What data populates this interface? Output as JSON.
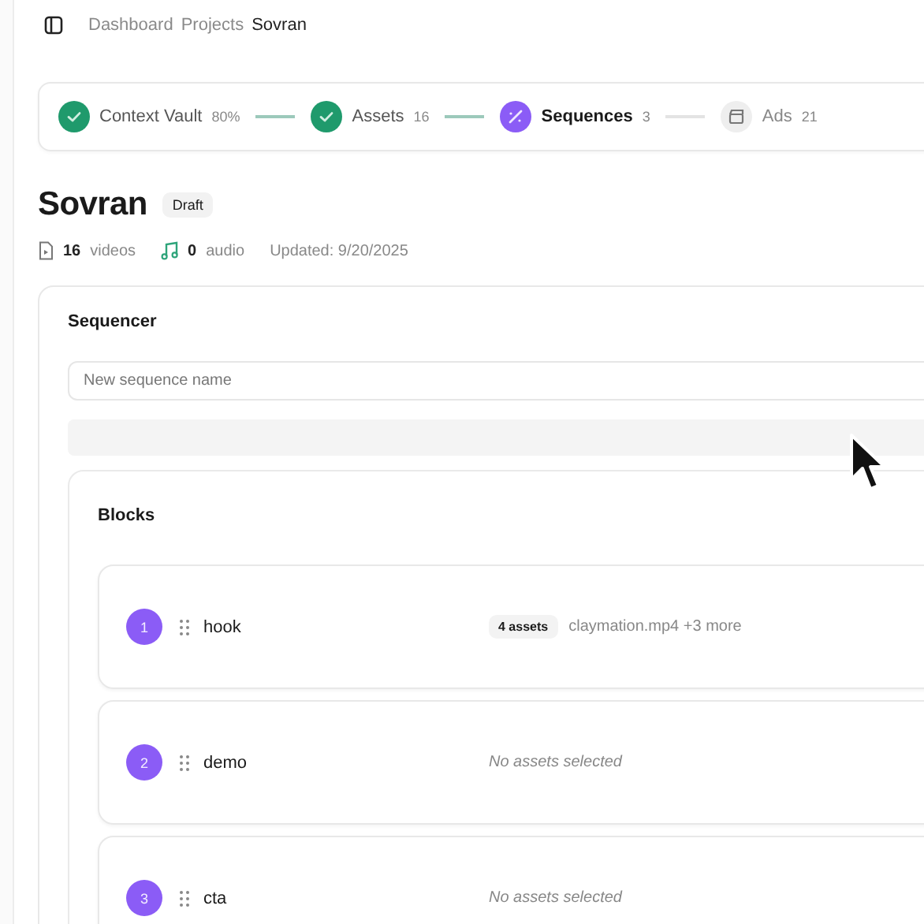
{
  "breadcrumb": [
    {
      "label": "Dashboard",
      "current": false
    },
    {
      "label": "Projects",
      "current": false
    },
    {
      "label": "Sovran",
      "current": true
    }
  ],
  "steps": [
    {
      "label": "Context Vault",
      "count": "80%",
      "completed": true,
      "selected": false
    },
    {
      "label": "Assets",
      "count": "16",
      "completed": true,
      "selected": false
    },
    {
      "label": "Sequences",
      "count": "3",
      "completed": false,
      "selected": true
    },
    {
      "label": "Ads",
      "count": "21",
      "completed": false,
      "selected": false
    }
  ],
  "project": {
    "title": "Sovran",
    "badge": "Draft",
    "videos_count": "16",
    "videos_label": "videos",
    "audio_count": "0",
    "audio_label": "audio",
    "updated": "Updated: 9/20/2025"
  },
  "sequencer": {
    "title": "Sequencer",
    "name_field": {
      "placeholder": "New sequence name"
    },
    "blocks_title": "Blocks",
    "blocks": [
      {
        "number": "1",
        "name": "hook",
        "assets_badge": "4 assets",
        "assets_text": "claymation.mp4 +3 more"
      },
      {
        "number": "2",
        "name": "demo",
        "note": "No assets selected"
      },
      {
        "number": "3",
        "name": "cta",
        "note": "No assets selected"
      }
    ]
  }
}
